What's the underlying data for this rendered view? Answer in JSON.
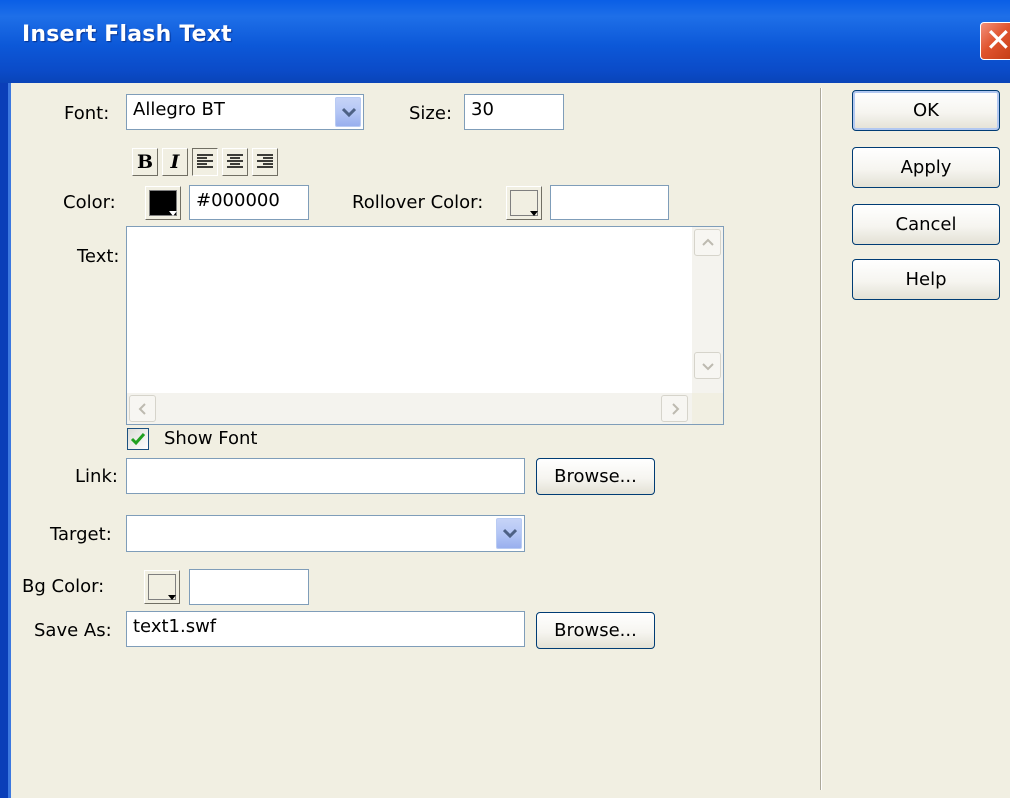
{
  "window": {
    "title": "Insert Flash Text",
    "close_icon": "close-x"
  },
  "font": {
    "label": "Font:",
    "value": "Allegro BT"
  },
  "size": {
    "label": "Size:",
    "value": "30"
  },
  "format_buttons": {
    "bold": "B",
    "italic": "I",
    "align_left": "align-left-icon",
    "align_center": "align-center-icon",
    "align_right": "align-right-icon"
  },
  "color": {
    "label": "Color:",
    "value": "#000000",
    "swatch": "#000000"
  },
  "rollover_color": {
    "label": "Rollover Color:",
    "value": ""
  },
  "text": {
    "label": "Text:",
    "value": ""
  },
  "show_font": {
    "label": "Show Font",
    "checked": true
  },
  "link": {
    "label": "Link:",
    "value": "",
    "browse_label": "Browse..."
  },
  "target": {
    "label": "Target:",
    "value": ""
  },
  "bg_color": {
    "label": "Bg Color:",
    "value": ""
  },
  "save_as": {
    "label": "Save As:",
    "value": "text1.swf",
    "browse_label": "Browse..."
  },
  "buttons": {
    "ok": "OK",
    "apply": "Apply",
    "cancel": "Cancel",
    "help": "Help"
  }
}
